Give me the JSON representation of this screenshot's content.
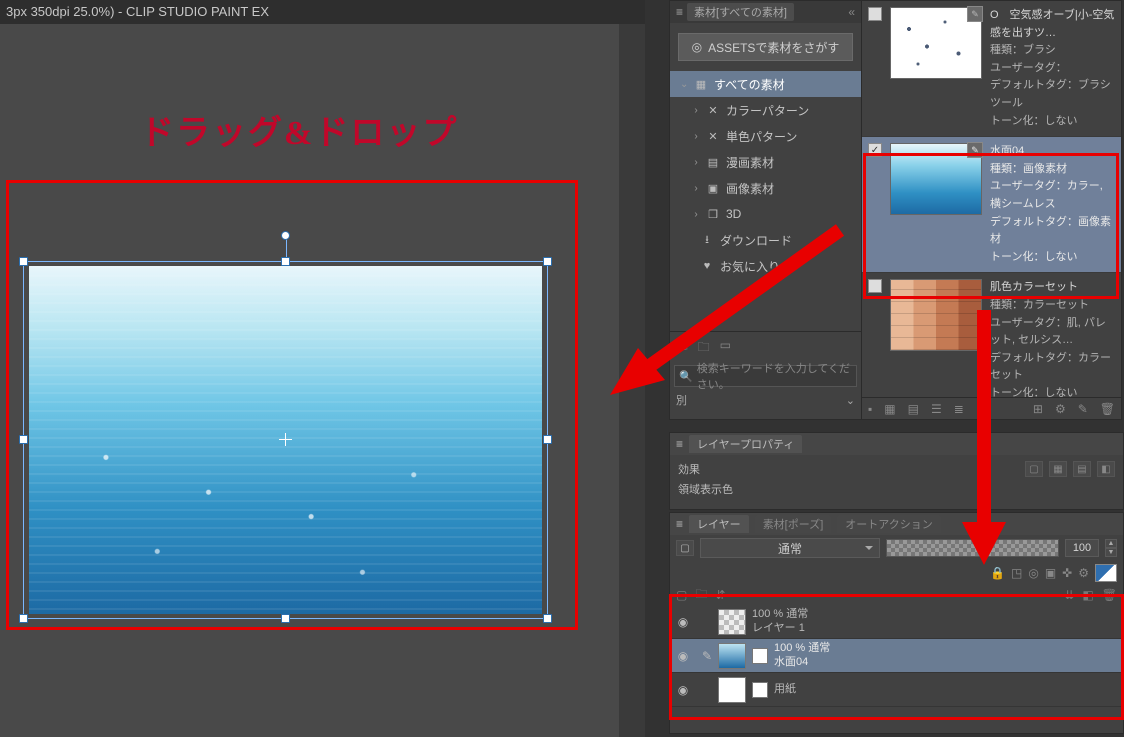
{
  "titlebar": "3px 350dpi 25.0%)  - CLIP STUDIO PAINT EX",
  "annotation": "ドラッグ&ドロップ",
  "material_panel": {
    "tab_label": "素材[すべての素材]",
    "assets_button": "ASSETSで素材をさがす",
    "tree": [
      {
        "label": "すべての素材",
        "root": true,
        "icon": "grid"
      },
      {
        "label": "カラーパターン",
        "icon": "x"
      },
      {
        "label": "単色パターン",
        "icon": "x"
      },
      {
        "label": "漫画素材",
        "icon": "manga"
      },
      {
        "label": "画像素材",
        "icon": "image"
      },
      {
        "label": "3D",
        "icon": "3d"
      },
      {
        "label": "ダウンロード",
        "icon": "download"
      },
      {
        "label": "お気に入り",
        "icon": "heart",
        "trunc": true
      }
    ],
    "search_placeholder": "検索キーワードを入力してください。",
    "filter_label": "別",
    "items": [
      {
        "name": "O　空気感オーブ|小-空気感を出すツ…",
        "kind_label": "種類：",
        "kind": "ブラシ",
        "usertag_label": "ユーザータグ：",
        "usertag": "",
        "deftag_label": "デフォルトタグ：",
        "deftag": "ブラシツール",
        "tone_label": "トーン化：",
        "tone": "しない",
        "thumb": "dots",
        "checked": false
      },
      {
        "name": "水面04",
        "kind_label": "種類：",
        "kind": "画像素材",
        "usertag_label": "ユーザータグ：",
        "usertag": "カラー, 横シームレス",
        "deftag_label": "デフォルトタグ：",
        "deftag": "画像素材",
        "tone_label": "トーン化：",
        "tone": "しない",
        "thumb": "water",
        "checked": true,
        "selected": true
      },
      {
        "name": "肌色カラーセット",
        "kind_label": "種類：",
        "kind": "カラーセット",
        "usertag_label": "ユーザータグ：",
        "usertag": "肌, パレット, セルシス…",
        "deftag_label": "デフォルトタグ：",
        "deftag": "カラーセット",
        "tone_label": "トーン化：",
        "tone": "しない",
        "thumb": "skin",
        "checked": false
      }
    ]
  },
  "layer_property": {
    "tab_label": "レイヤープロパティ",
    "effect_label": "効果",
    "region_label": "領域表示色"
  },
  "layers_panel": {
    "tab_label": "レイヤー",
    "tab2": "素材[ポーズ]",
    "tab3": "オートアクション",
    "blend_mode": "通常",
    "opacity": "100",
    "layers": [
      {
        "opacity_line": "100 % 通常",
        "name": "レイヤー 1",
        "thumb": "checker",
        "visible": true,
        "selected": false
      },
      {
        "opacity_line": "100 % 通常",
        "name": "水面04",
        "thumb": "water",
        "visible": true,
        "selected": true,
        "editing": true,
        "mini": true
      },
      {
        "opacity_line": "",
        "name": "用紙",
        "thumb": "white",
        "visible": true,
        "selected": false,
        "mini": true
      }
    ]
  }
}
